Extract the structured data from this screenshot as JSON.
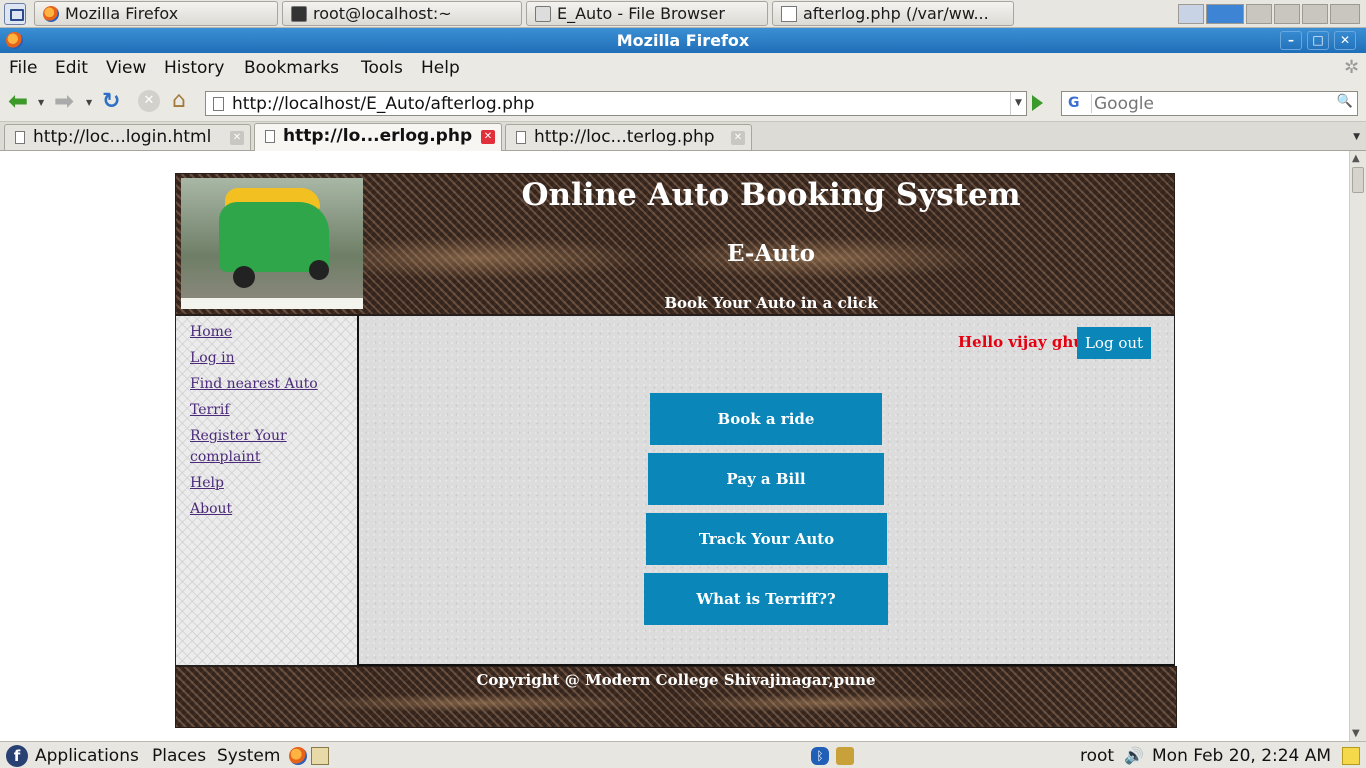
{
  "taskbar": {
    "items": [
      {
        "label": "Mozilla Firefox",
        "icon": "firefox-icon"
      },
      {
        "label": "root@localhost:~",
        "icon": "terminal-icon"
      },
      {
        "label": "E_Auto - File Browser",
        "icon": "folder-icon"
      },
      {
        "label": "afterlog.php (/var/ww...",
        "icon": "text-editor-icon"
      }
    ]
  },
  "window": {
    "title": "Mozilla Firefox",
    "min": "–",
    "max": "□",
    "close": "✕"
  },
  "menubar": {
    "items": [
      "File",
      "Edit",
      "View",
      "History",
      "Bookmarks",
      "Tools",
      "Help"
    ]
  },
  "navbar": {
    "url": "http://localhost/E_Auto/afterlog.php",
    "search_placeholder": "Google",
    "search_engine": "G"
  },
  "tabs": [
    {
      "label": "http://loc...login.html",
      "active": false
    },
    {
      "label": "http://lo...erlog.php",
      "active": true
    },
    {
      "label": "http://loc...terlog.php",
      "active": false
    }
  ],
  "site": {
    "title": "Online Auto Booking System",
    "subtitle": "E-Auto",
    "tagline": "Book Your Auto in a click",
    "nav": [
      "Home",
      "Log in",
      "Find nearest Auto",
      "Terrif",
      "Register Your complaint",
      "Help",
      "About"
    ],
    "greeting": "Hello vijay ghule",
    "logout": "Log out",
    "actions": [
      "Book a ride",
      "Pay a Bill",
      "Track Your Auto",
      "What is Terriff??"
    ],
    "footer": "Copyright @ Modern College Shivajinagar,pune"
  },
  "panel": {
    "applications": "Applications",
    "places": "Places",
    "system": "System",
    "user": "root",
    "clock": "Mon Feb 20,  2:24 AM"
  },
  "colors": {
    "accent": "#0a86b8",
    "greeting": "#e4000f",
    "titlebar": "#2a7fc8"
  }
}
